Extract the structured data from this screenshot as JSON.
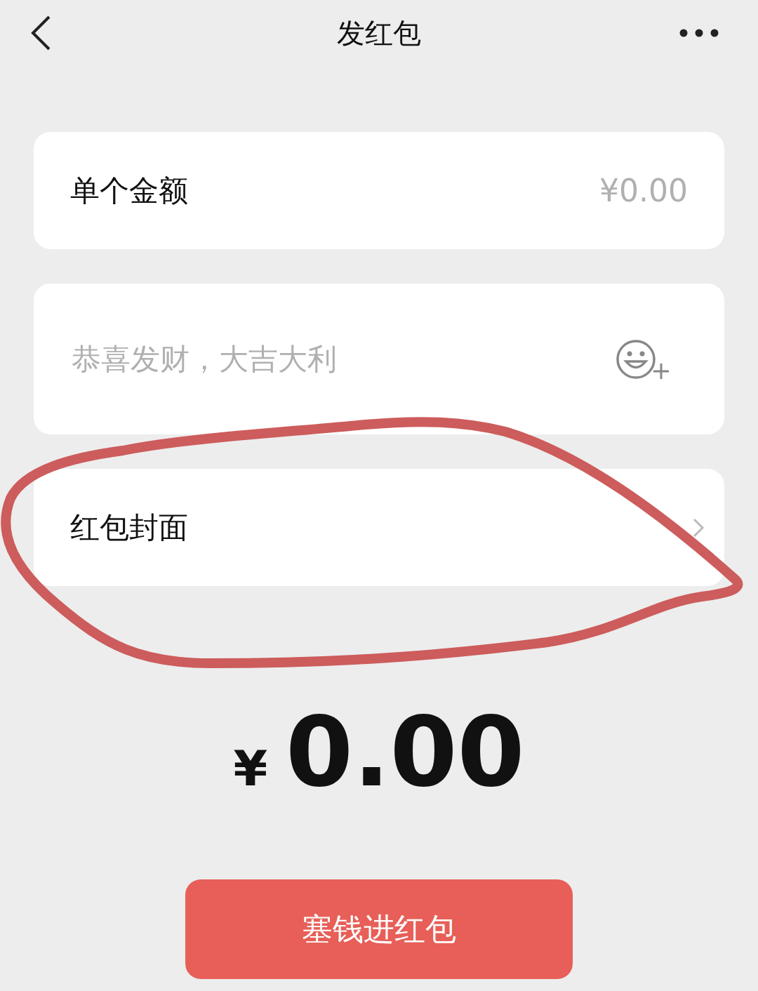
{
  "header": {
    "title": "发红包"
  },
  "fields": [
    {
      "kind": "amount",
      "label": "单个金额",
      "placeholder": "¥0.00"
    },
    {
      "kind": "message",
      "placeholder": "恭喜发财，大吉大利"
    },
    {
      "kind": "cover",
      "label": "红包封面"
    }
  ],
  "total": {
    "currency": "¥",
    "amount": "0.00"
  },
  "submit_button": {
    "label": "塞钱进红包"
  },
  "annotation": {
    "kind": "ellipse",
    "color": "#cd5c5c"
  }
}
